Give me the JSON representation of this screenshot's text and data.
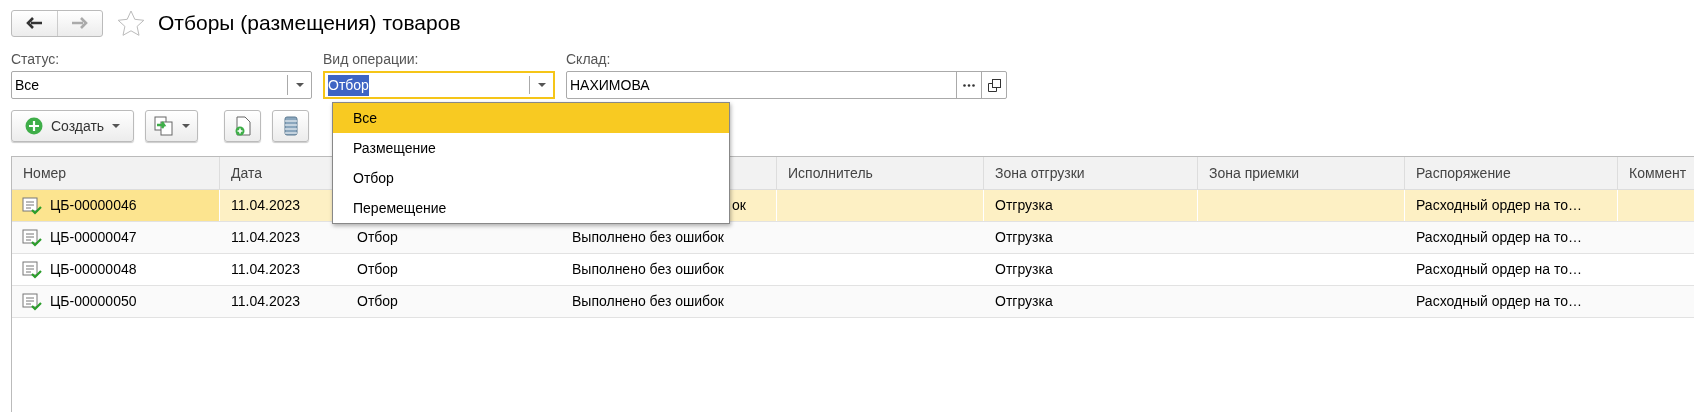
{
  "window": {
    "title": "Отборы (размещения) товаров",
    "favorite": false
  },
  "filters": [
    {
      "label": "Статус:",
      "value": "Все",
      "kind": "combo",
      "focused": false
    },
    {
      "label": "Вид операции:",
      "value": "Отбор",
      "kind": "combo",
      "focused": true
    },
    {
      "label": "Склад:",
      "value": "НАХИМОВА",
      "kind": "choice",
      "focused": false
    }
  ],
  "toolbar": [
    {
      "kind": "create",
      "label": "Создать"
    },
    {
      "kind": "copy"
    },
    {
      "kind": "new-document"
    },
    {
      "kind": "list"
    }
  ],
  "dropdown": {
    "items": [
      {
        "label": "Все",
        "selected": true
      },
      {
        "label": "Размещение",
        "selected": false
      },
      {
        "label": "Отбор",
        "selected": false
      },
      {
        "label": "Перемещение",
        "selected": false
      }
    ]
  },
  "table": {
    "columns": [
      {
        "label": "Номер"
      },
      {
        "label": "Дата"
      },
      {},
      {},
      {
        "label": "Исполнитель"
      },
      {
        "label": "Зона отгрузки"
      },
      {
        "label": "Зона приемки"
      },
      {
        "label": "Распоряжение"
      },
      {
        "label": "Коммент"
      }
    ],
    "rows": [
      {
        "selected": true,
        "cells": [
          "ЦБ-00000046",
          "11.04.2023",
          null,
          "ок",
          null,
          "Отгрузка",
          null,
          "Расходный ордер на то…",
          null
        ]
      },
      {
        "selected": false,
        "cells": [
          "ЦБ-00000047",
          "11.04.2023",
          "Отбор",
          "Выполнено без ошибок",
          null,
          "Отгрузка",
          null,
          "Расходный ордер на то…",
          null
        ]
      },
      {
        "selected": false,
        "cells": [
          "ЦБ-00000048",
          "11.04.2023",
          "Отбор",
          "Выполнено без ошибок",
          null,
          "Отгрузка",
          null,
          "Расходный ордер на то…",
          null
        ]
      },
      {
        "selected": false,
        "cells": [
          "ЦБ-00000050",
          "11.04.2023",
          "Отбор",
          "Выполнено без ошибок",
          null,
          "Отгрузка",
          null,
          "Расходный ордер на то…",
          null
        ]
      }
    ]
  }
}
